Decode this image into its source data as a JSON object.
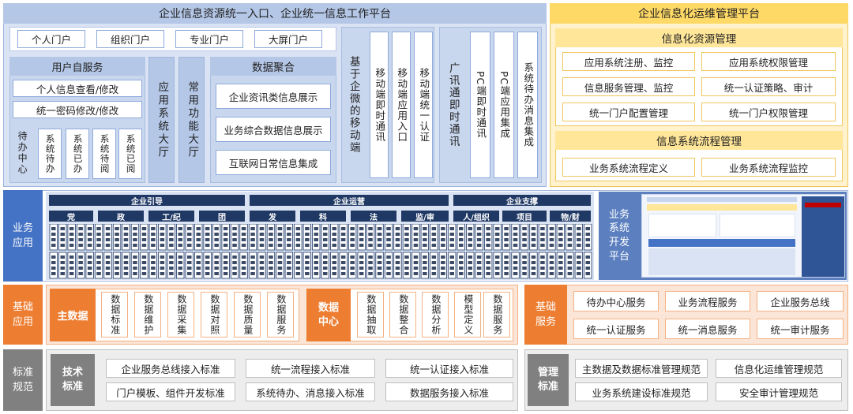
{
  "portal": {
    "title": "企业信息资源统一入口、企业统一信息工作平台",
    "entrances": [
      "个人门户",
      "组织门户",
      "专业门户",
      "大屏门户"
    ],
    "self_service": {
      "title": "用户自服务",
      "items": [
        "个人信息查看/修改",
        "统一密码修改/修改"
      ]
    },
    "todo": {
      "label": "待办中心",
      "items": [
        "系统待办",
        "系统已办",
        "系统待阅",
        "系统已阅"
      ]
    },
    "app_hall": "应用系统大厅",
    "func_hall": "常用功能大厅",
    "data_aggregate": {
      "title": "数据聚合",
      "items": [
        "企业资讯类信息展示",
        "业务综合数据信息展示",
        "互联网日常信息集成"
      ]
    },
    "wecom": {
      "label": "基于企微的移动端",
      "items": [
        "移动端即时通讯",
        "移动端应用入口",
        "移动端统一认证"
      ]
    },
    "guangxun": {
      "label": "广讯通即时通讯",
      "items": [
        "PC端即时通讯",
        "PC端应用集成",
        "系统待办消息集成"
      ]
    }
  },
  "ops_platform": {
    "title": "企业信息化运维管理平台",
    "resource_mgmt": {
      "title": "信息化资源管理",
      "items": [
        "应用系统注册、监控",
        "应用系统权限管理",
        "信息服务管理、监控",
        "统一认证策略、审计",
        "统一门户配置管理",
        "统一门户权限管理"
      ]
    },
    "flow_mgmt": {
      "title": "信息系统流程管理",
      "items": [
        "业务系统流程定义",
        "业务系统流程监控"
      ]
    }
  },
  "business": {
    "label": "业务应用",
    "groups": [
      "企业引导",
      "企业运营",
      "企业支撑"
    ],
    "categories": [
      "党",
      "政",
      "工/纪",
      "团",
      "发",
      "科",
      "法",
      "监/审",
      "人/组织",
      "项目",
      "物/财"
    ],
    "dev_platform": "业务系统开发平台"
  },
  "base_app": {
    "label": "基础应用",
    "master_data": "主数据",
    "master_items": [
      "数据标准",
      "数据维护",
      "数据采集",
      "数据对照",
      "数据质量",
      "数据服务"
    ],
    "data_center": "数据中心",
    "center_items": [
      "数据抽取",
      "数据整合",
      "数据分析",
      "模型定义",
      "数据服务"
    ]
  },
  "base_service": {
    "label": "基础服务",
    "items": [
      "待办中心服务",
      "业务流程服务",
      "企业服务总线",
      "统一认证服务",
      "统一消息服务",
      "统一审计服务"
    ]
  },
  "standards": {
    "label": "标准规范",
    "tech_label": "技术标准",
    "tech_items": [
      "企业服务总线接入标准",
      "统一流程接入标准",
      "统一认证接入标准",
      "门户模板、组件开发标准",
      "系统待办、消息接入标准",
      "数据服务接入标准"
    ],
    "mgmt_label": "管理标准",
    "mgmt_items": [
      "主数据及数据标准管理规范",
      "信息化运维管理规范",
      "业务系统建设标准规范",
      "安全审计管理规范"
    ]
  },
  "colors": {
    "blue_side": "#4472c4",
    "blue_light": "#dae3f3",
    "orange": "#ed7d31",
    "orange_light": "#fbe5d6",
    "gold": "#ffc000",
    "gold_light": "#fff2cc",
    "gray": "#808080",
    "navy": "#1f3864"
  }
}
